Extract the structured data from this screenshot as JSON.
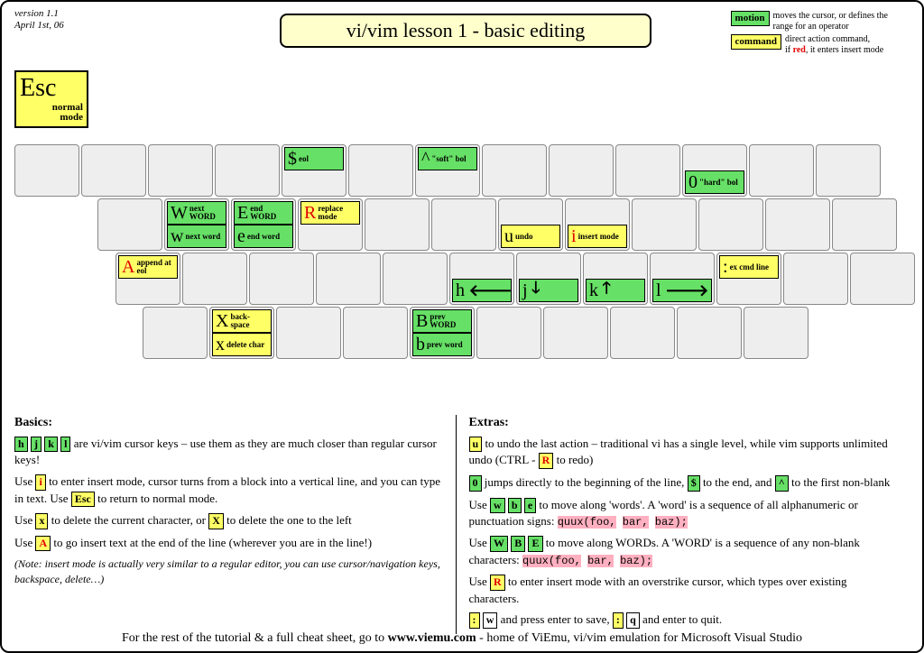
{
  "meta": {
    "version_line1": "version 1.1",
    "version_line2": "April 1st, 06",
    "title": "vi/vim lesson 1 - basic editing"
  },
  "legend": {
    "motion": {
      "swatch": "motion",
      "text": "moves the cursor, or defines the range for an operator"
    },
    "command": {
      "swatch": "command",
      "text_a": "direct action command,",
      "text_b": "if ",
      "text_red": "red",
      "text_c": ", it enters insert mode"
    }
  },
  "esc": {
    "glyph": "Esc",
    "label1": "normal",
    "label2": "mode"
  },
  "keys": {
    "dollar": {
      "g": "$",
      "l": "eol"
    },
    "caret": {
      "g": "^",
      "l": "\"soft\" bol"
    },
    "zero": {
      "g": "0",
      "l": "\"hard\" bol"
    },
    "Wcap": {
      "g": "W",
      "l": "next WORD"
    },
    "w": {
      "g": "w",
      "l": "next word"
    },
    "Ecap": {
      "g": "E",
      "l": "end WORD"
    },
    "e": {
      "g": "e",
      "l": "end word"
    },
    "Rcap": {
      "g": "R",
      "l": "replace mode"
    },
    "u": {
      "g": "u",
      "l": "undo"
    },
    "i": {
      "g": "i",
      "l": "insert mode"
    },
    "Acap": {
      "g": "A",
      "l": "append at eol"
    },
    "h": {
      "g": "h"
    },
    "j": {
      "g": "j"
    },
    "k": {
      "g": "k"
    },
    "l": {
      "g": "l"
    },
    "colon": {
      "g": ":",
      "l": "ex cmd line"
    },
    "Xcap": {
      "g": "X",
      "l": "back- space"
    },
    "x": {
      "g": "x",
      "l": "delete char"
    },
    "Bcap": {
      "g": "B",
      "l": "prev WORD"
    },
    "b": {
      "g": "b",
      "l": "prev word"
    }
  },
  "basics": {
    "heading": "Basics:",
    "p1_a": "are vi/vim cursor keys – use them as they are  much closer than regular cursor keys!",
    "p2_a": "Use ",
    "p2_b": " to enter insert mode, cursor turns from a block into a vertical line, and you can type in text. Use ",
    "p2_c": " to  return to normal mode.",
    "p3_a": "Use ",
    "p3_b": " to delete the current character, or ",
    "p3_c": " to delete the one to the left",
    "p4_a": "Use ",
    "p4_b": " to go insert text at the end of the line (wherever you are in the line!)",
    "note": "(Note: insert mode is actually very similar to a regular editor, you can use cursor/navigation keys, backspace,  delete…)",
    "k": {
      "h": "h",
      "j": "j",
      "k": "k",
      "l": "l",
      "i": "i",
      "Esc": "Esc",
      "x": "x",
      "X": "X",
      "A": "A"
    }
  },
  "extras": {
    "heading": "Extras:",
    "p1_a": " to undo the last action – traditional vi has a single level, while vim supports unlimited undo (CTRL - ",
    "p1_b": " to redo)",
    "p2_a": " jumps directly to the beginning of the line, ",
    "p2_b": " to the end, and ",
    "p2_c": " to the first non-blank",
    "p3_a": "Use ",
    "p3_b": " to move along 'words'. A 'word' is a sequence of all alphanumeric or punctuation signs:   ",
    "code3": "quux(foo, bar, baz);",
    "p4_a": "Use ",
    "p4_b": " to move along WORDs. A 'WORD' is a sequence of any non-blank characters:   ",
    "code4": "quux(foo, bar, baz);",
    "p5_a": "Use ",
    "p5_b": " to enter insert mode with an overstrike cursor, which types over existing characters.",
    "p6_a": " and press enter to save, ",
    "p6_b": " and enter to quit.",
    "k": {
      "u": "u",
      "R": "R",
      "zero": "0",
      "dollar": "$",
      "caret": "^",
      "w": "w",
      "b": "b",
      "e": "e",
      "W": "W",
      "B": "B",
      "E": "E",
      "colon": ":",
      "wkey": "w",
      "qkey": "q"
    }
  },
  "footer": {
    "a": "For the rest of the tutorial & a full cheat sheet, go to ",
    "site": "www.viemu.com",
    "b": " - home of ViEmu, vi/vim emulation for Microsoft Visual Studio"
  }
}
